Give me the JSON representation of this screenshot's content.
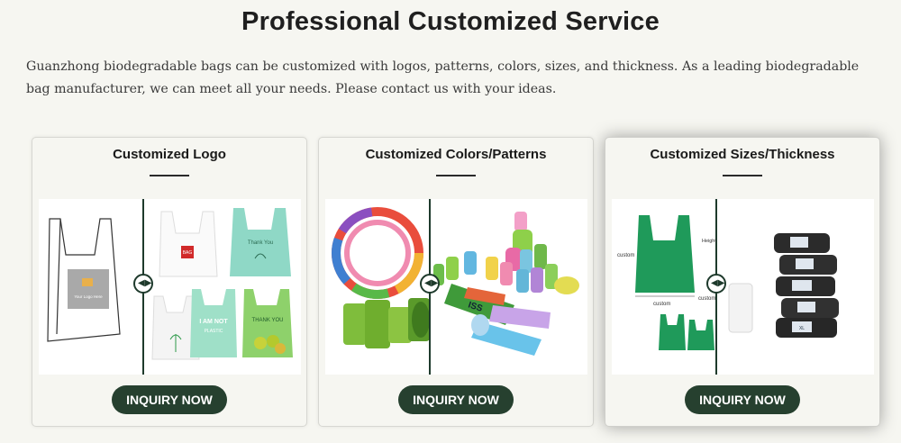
{
  "header": {
    "title": "Professional Customized Service",
    "intro": "Guanzhong biodegradable bags can be customized with logos, patterns, colors, sizes, and thickness. As a leading biodegradable bag manufacturer, we can meet all your needs. Please contact us with your ideas."
  },
  "cards": [
    {
      "title": "Customized Logo",
      "button_label": "INQUIRY NOW",
      "labels": {
        "logo_placeholder": "Your Logo Here",
        "bag_logo": "BAG",
        "bag_thank_you": "Thank You",
        "bag_i_am_not": "I AM NOT",
        "bag_plastic": "PLASTIC",
        "bag_thank_you_caps": "THANK YOU"
      }
    },
    {
      "title": "Customized Colors/Patterns",
      "button_label": "INQUIRY NOW",
      "labels": {
        "roll_text": "ISS"
      }
    },
    {
      "title": "Customized Sizes/Thickness",
      "button_label": "INQUIRY NOW",
      "labels": {
        "custom_left": "custom",
        "custom_bottom": "custom",
        "custom_mid": "custom",
        "height": "Height",
        "size_xl": "XL"
      }
    }
  ],
  "colors": {
    "background": "#f6f6f1",
    "button": "#26402f",
    "divider": "#1e3a2c",
    "bag_green": "#1f9a5a"
  },
  "icons": {
    "slider_handle": "left-right-arrows-icon"
  }
}
